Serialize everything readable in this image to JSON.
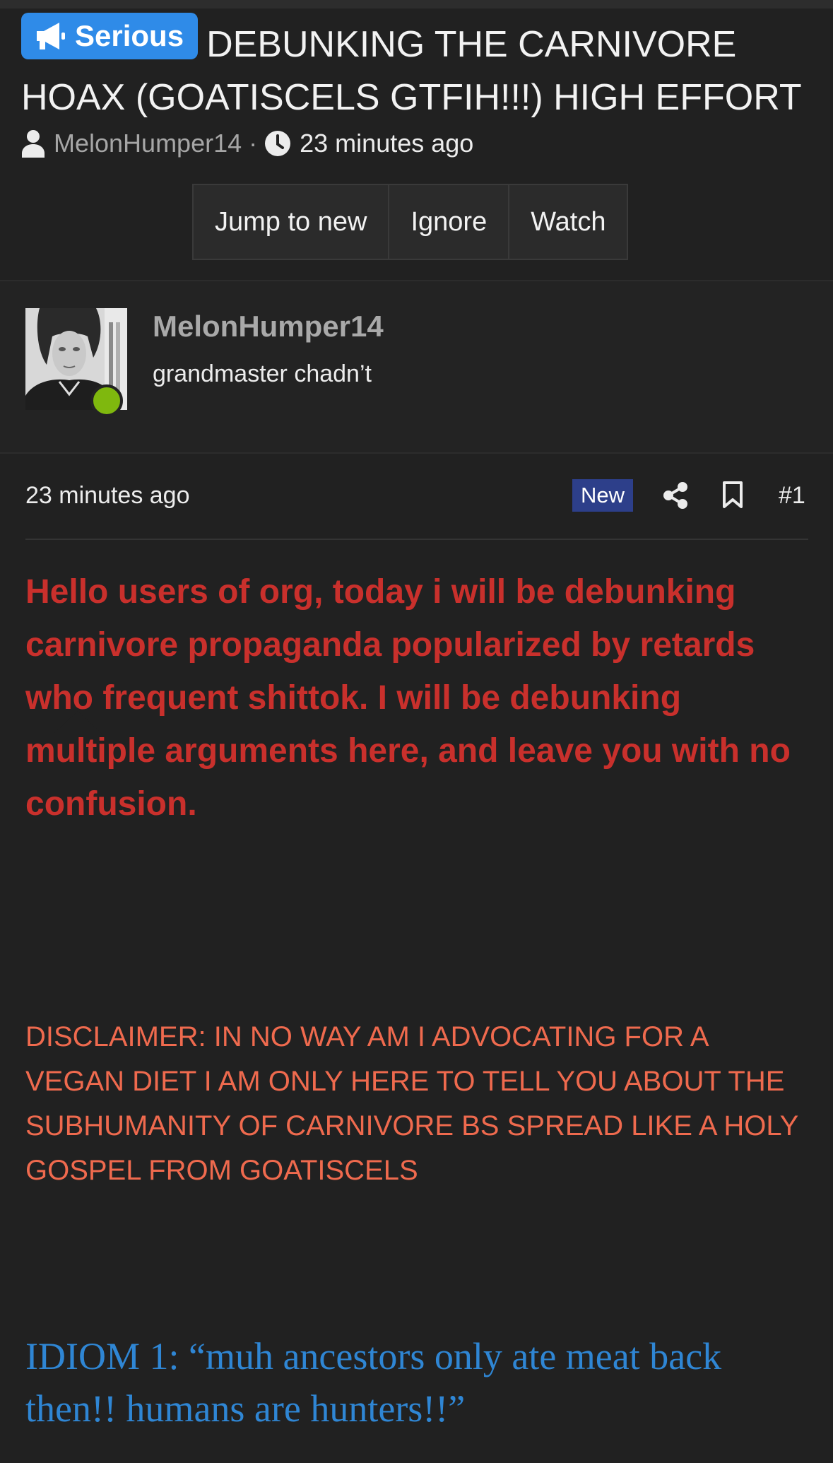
{
  "thread": {
    "prefix_label": "Serious",
    "prefix_icon": "megaphone-icon",
    "title": "DEBUNKING THE CARNIVORE HOAX (GOATISCELS GTFIH!!!) HIGH EFFORT",
    "author": "MelonHumper14",
    "separator": "·",
    "time": "23 minutes ago",
    "buttons": [
      "Jump to new",
      "Ignore",
      "Watch"
    ],
    "prefix_color": "#2f8be8"
  },
  "post": {
    "username": "MelonHumper14",
    "user_title": "grandmaster chadn’t",
    "online_status_color": "#7fb80e",
    "time": "23 minutes ago",
    "new_label": "New",
    "post_number": "#1",
    "paragraphs": {
      "intro": "Hello users of org, today i will be debunking carnivore propaganda popularized by retards who frequent shittok. I will be debunking multiple arguments here, and leave you with no confusion.",
      "disclaimer": "DISCLAIMER: IN NO WAY AM I ADVOCATING FOR A VEGAN DIET I AM ONLY HERE TO TELL YOU ABOUT THE SUBHUMANITY OF CARNIVORE BS SPREAD LIKE A HOLY GOSPEL FROM GOATISCELS",
      "idiom": "IDIOM 1: “muh ancestors only ate meat back then!! humans are hunters!!”"
    },
    "text_colors": {
      "intro": "#c9302c",
      "disclaimer": "#ef6a4e",
      "idiom": "#2f86d4"
    }
  }
}
